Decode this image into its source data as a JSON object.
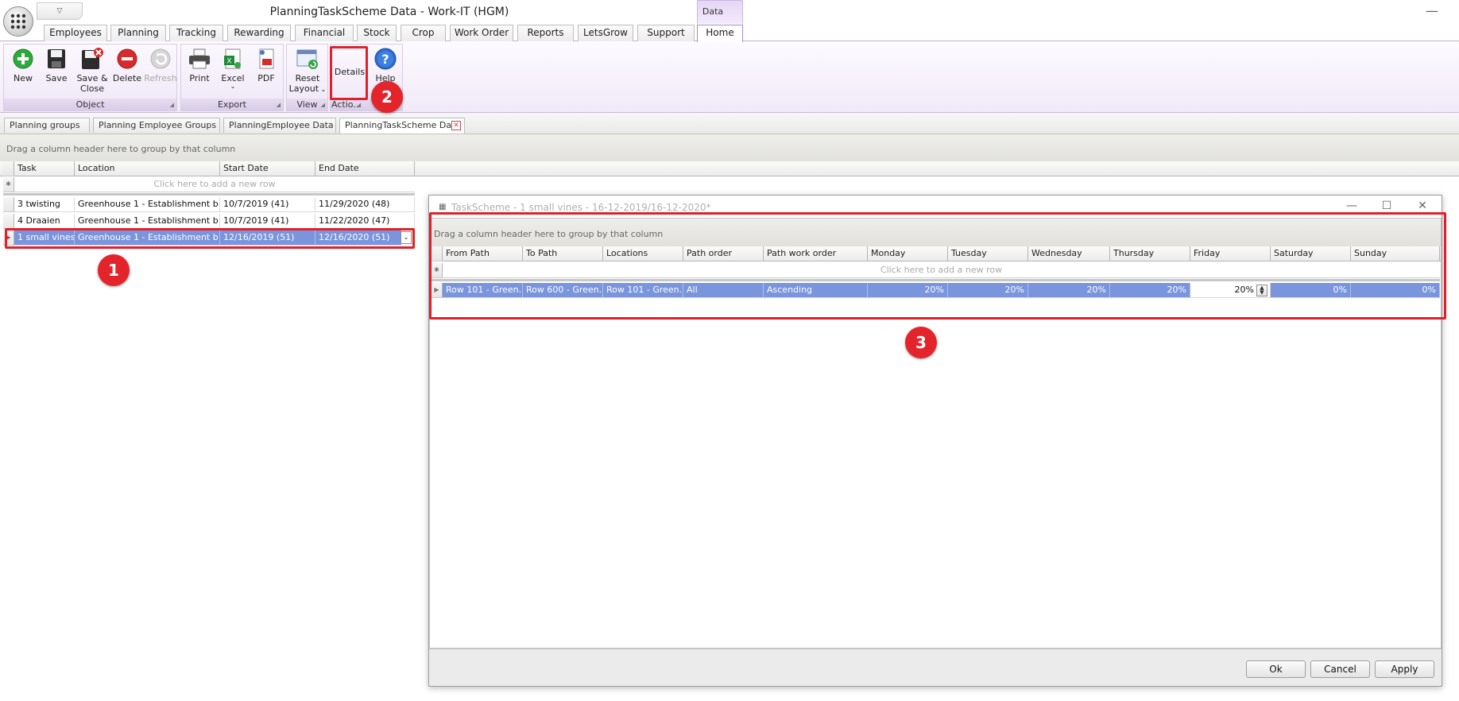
{
  "window": {
    "title": "PlanningTaskScheme Data - Work-IT (HGM)",
    "qat_dropdown": "▽",
    "minimize": "—",
    "context_tab_group": "Data"
  },
  "ribbon_tabs": [
    "Employees",
    "Planning",
    "Tracking",
    "Rewarding",
    "Financial",
    "Stock",
    "Crop",
    "Work Order",
    "Reports",
    "LetsGrow",
    "Support",
    "Home"
  ],
  "ribbon": {
    "object_group": {
      "label": "Object",
      "new": "New",
      "save": "Save",
      "save_close_1": "Save &",
      "save_close_2": "Close",
      "delete": "Delete",
      "refresh": "Refresh"
    },
    "export_group": {
      "label": "Export",
      "print": "Print",
      "excel": "Excel",
      "pdf": "PDF"
    },
    "view_group": {
      "label": "View",
      "reset_1": "Reset",
      "reset_2": "Layout"
    },
    "actions_group": {
      "label": "Actio...",
      "details": "Details",
      "help": "Help"
    }
  },
  "doc_tabs": [
    "Planning groups",
    "Planning Employee Groups",
    "PlanningEmployee Data",
    "PlanningTaskScheme Data"
  ],
  "main_grid": {
    "group_hint": "Drag a column header here to group by that column",
    "columns": [
      "Task",
      "Location",
      "Start Date",
      "End Date"
    ],
    "new_row": "Click here to add a new row",
    "rows": [
      {
        "task": "3 twisting",
        "location": "Greenhouse 1 - Establishment b",
        "start": "10/7/2019 (41)",
        "end": "11/29/2020 (48)"
      },
      {
        "task": "4 Draaien",
        "location": "Greenhouse 1 - Establishment b",
        "start": "10/7/2019 (41)",
        "end": "11/22/2020 (47)"
      },
      {
        "task": "1 small vines",
        "location": "Greenhouse 1 - Establishment b",
        "start": "12/16/2019 (51)",
        "end": "12/16/2020 (51)"
      }
    ]
  },
  "dialog": {
    "title": "TaskScheme - 1 small vines - 16-12-2019/16-12-2020*",
    "group_hint": "Drag a column header here to group by that column",
    "columns": [
      "From Path",
      "To Path",
      "Locations",
      "Path order",
      "Path work order",
      "Monday",
      "Tuesday",
      "Wednesday",
      "Thursday",
      "Friday",
      "Saturday",
      "Sunday"
    ],
    "new_row": "Click here to add a new row",
    "row": {
      "from_path": "Row 101 - Green...",
      "to_path": "Row 600 - Green...",
      "locations": "Row 101 - Green...",
      "path_order": "All",
      "path_work_order": "Ascending",
      "monday": "20%",
      "tuesday": "20%",
      "wednesday": "20%",
      "thursday": "20%",
      "friday": "20%",
      "saturday": "0%",
      "sunday": "0%"
    },
    "buttons": {
      "ok": "Ok",
      "cancel": "Cancel",
      "apply": "Apply"
    }
  },
  "annotations": [
    "1",
    "2",
    "3"
  ],
  "colors": {
    "highlight": "#e0202a",
    "selection": "#7a95dc",
    "ribbon": "#f1e9f8"
  }
}
